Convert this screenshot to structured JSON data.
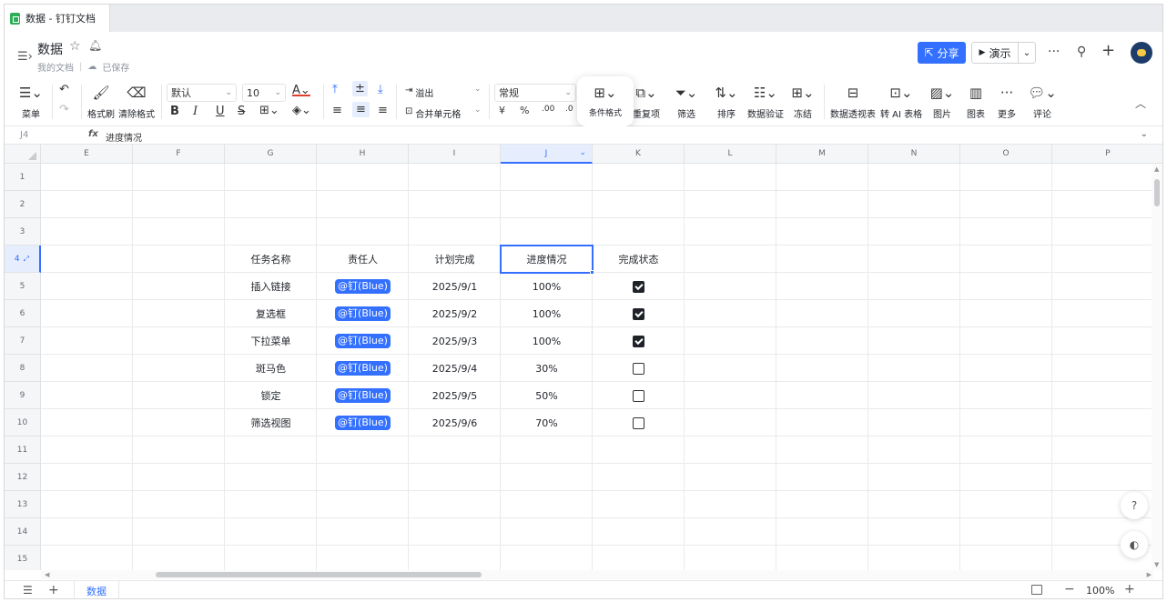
{
  "tab": {
    "title": "数据 - 钉钉文档"
  },
  "header": {
    "doc_title": "数据",
    "breadcrumb": [
      "我的文档",
      "已保存"
    ],
    "share_label": "分享",
    "present_label": "演示"
  },
  "toolbar": {
    "menu": "菜单",
    "format_painter": "格式刷",
    "clear_format": "清除格式",
    "font_family": "默认",
    "font_size": "10",
    "overflow": "溢出",
    "merge_cells": "合并单元格",
    "number_format": "常规",
    "currency_symbol": "¥",
    "percent_symbol": "%",
    "decimal_increase": ".00",
    "conditional_format": "条件格式",
    "duplicates": "重复项",
    "filter": "筛选",
    "sort": "排序",
    "data_validation": "数据验证",
    "freeze": "冻结",
    "pivot_table": "数据透视表",
    "to_ai_table": "转 AI 表格",
    "image": "图片",
    "chart": "图表",
    "more": "更多",
    "comment": "评论"
  },
  "formula_bar": {
    "cell_ref": "J4",
    "fx": "fx",
    "content": "进度情况"
  },
  "columns": [
    "E",
    "F",
    "G",
    "H",
    "I",
    "J",
    "K",
    "L",
    "M",
    "N",
    "O",
    "P"
  ],
  "rows": [
    "1",
    "2",
    "3",
    "4",
    "5",
    "6",
    "7",
    "8",
    "9",
    "10",
    "11",
    "12",
    "13",
    "14",
    "15"
  ],
  "table": {
    "headers": [
      "任务名称",
      "责任人",
      "计划完成",
      "进度情况",
      "完成状态"
    ],
    "rows": [
      {
        "task": "插入链接",
        "owner": "@钉(Blue)",
        "date": "2025/9/1",
        "progress": "100%",
        "done": true
      },
      {
        "task": "复选框",
        "owner": "@钉(Blue)",
        "date": "2025/9/2",
        "progress": "100%",
        "done": true
      },
      {
        "task": "下拉菜单",
        "owner": "@钉(Blue)",
        "date": "2025/9/3",
        "progress": "100%",
        "done": true
      },
      {
        "task": "斑马色",
        "owner": "@钉(Blue)",
        "date": "2025/9/4",
        "progress": "30%",
        "done": false
      },
      {
        "task": "锁定",
        "owner": "@钉(Blue)",
        "date": "2025/9/5",
        "progress": "50%",
        "done": false
      },
      {
        "task": "筛选视图",
        "owner": "@钉(Blue)",
        "date": "2025/9/6",
        "progress": "70%",
        "done": false
      }
    ]
  },
  "sheetbar": {
    "sheet_name": "数据",
    "zoom": "100%"
  },
  "colors": {
    "accent": "#3370ff"
  }
}
